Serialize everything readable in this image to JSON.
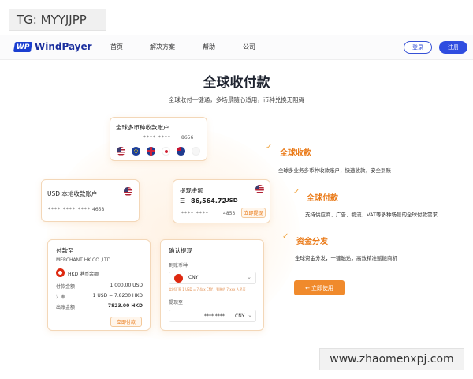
{
  "overlay_tag": "TG: MYYJJPP",
  "watermark": "www.zhaomenxpj.com",
  "header": {
    "brand_mark": "WP",
    "brand": "WindPayer",
    "nav": [
      "首页",
      "解决方案",
      "帮助",
      "公司"
    ],
    "login": "登录",
    "register": "注册"
  },
  "hero": {
    "title": "全球收付款",
    "subtitle": "全球收付一键通，多场景随心适用，币种兑换无阻碍"
  },
  "card_multi": {
    "title": "全球多币种收款账户",
    "masked": "**** ****",
    "last4": "8656",
    "flags": [
      "us-flag",
      "eu-flag",
      "uk-flag",
      "jp-flag",
      "au-flag",
      "other-flag"
    ]
  },
  "card_usd": {
    "title": "USD 本地收款账户",
    "masked": "**** **** ****",
    "last4": "4658"
  },
  "card_withdraw": {
    "title": "提现金额",
    "amount": "86,564.72",
    "currency": "USD",
    "masked": "**** ****",
    "last4": "4853",
    "button": "立即提现"
  },
  "card_pay": {
    "title": "付款至",
    "merchant": "MERCHANT  HK CO.,LTD",
    "account_label": "HKD 港币余额",
    "rows": [
      {
        "label": "付款金额",
        "value": "1,000.00 USD"
      },
      {
        "label": "汇率",
        "value": "1 USD = 7.8230 HKD"
      },
      {
        "label": "出账金额",
        "value": "7823.00 HKD"
      }
    ],
    "button": "立即付款"
  },
  "card_confirm": {
    "title": "确认提现",
    "currency_label": "到账币种",
    "currency_value": "CNY",
    "note": "实时汇率 1 USD = 7.4xx CNY，到账约 7.xxx 人民币",
    "to_label": "提现至",
    "to_masked": "**** ****",
    "to_currency": "CNY"
  },
  "features": [
    {
      "title": "全球收款",
      "desc": "全球多业务多币种收款账户，快速收款，安全到账"
    },
    {
      "title": "全球付款",
      "desc": "支持供应商、广告、物流、VAT等多种场景的全球付款需求"
    },
    {
      "title": "资金分发",
      "desc": "全球资金分发，一键触达，高效精准赋能商机"
    }
  ],
  "cta": "立即使用",
  "colors": {
    "brand_blue": "#2f4de0",
    "accent_orange": "#f08a2c",
    "feature_orange": "#ea7a18"
  }
}
